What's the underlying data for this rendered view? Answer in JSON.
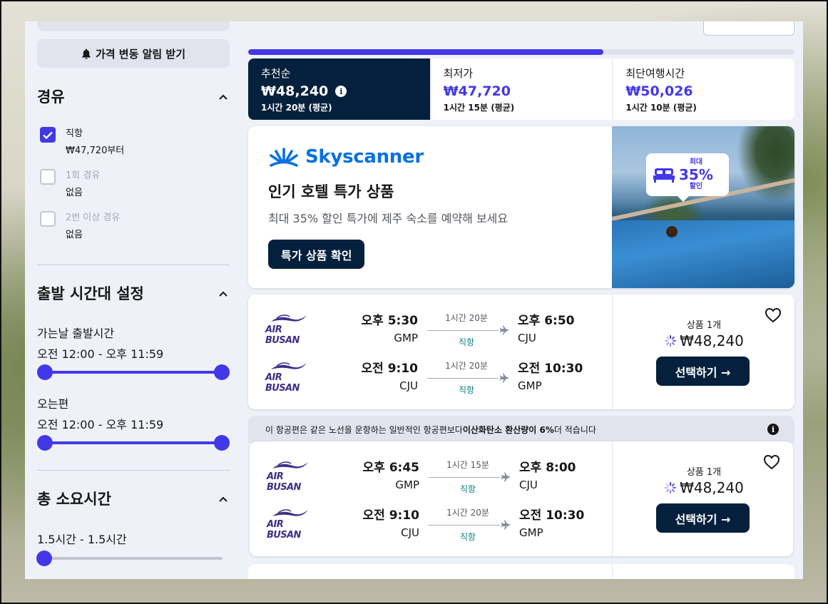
{
  "sidebar": {
    "price_alert_label": "가격 변동 알림 받기",
    "stops": {
      "title": "경유",
      "options": [
        {
          "label": "직항",
          "sub": "₩47,720부터",
          "checked": true,
          "disabled": false
        },
        {
          "label": "1회 경유",
          "sub": "없음",
          "checked": false,
          "disabled": true
        },
        {
          "label": "2번 이상 경유",
          "sub": "없음",
          "checked": false,
          "disabled": true
        }
      ]
    },
    "departure_times": {
      "title": "출발 시간대 설정",
      "outbound_label": "가는날 출발시간",
      "outbound_range": "오전 12:00 - 오후 11:59",
      "return_label": "오는편",
      "return_range": "오전 12:00 - 오후 11:59"
    },
    "duration": {
      "title": "총 소요시간",
      "range": "1.5시간 - 1.5시간"
    }
  },
  "progress": {
    "fraction": 0.65
  },
  "sort_tabs": [
    {
      "label": "추천순",
      "price": "₩48,240",
      "sub": "1시간 20분 (평균)",
      "active": true
    },
    {
      "label": "최저가",
      "price": "₩47,720",
      "sub": "1시간 15분 (평균)",
      "active": false
    },
    {
      "label": "최단여행시간",
      "price": "₩50,026",
      "sub": "1시간 10분 (평균)",
      "active": false
    }
  ],
  "ad": {
    "brand": "Skyscanner",
    "title": "인기 호텔 특가 상품",
    "subtitle": "최대 35% 할인 특가에 제주 숙소를 예약해 보세요",
    "button_label": "특가 상품 확인",
    "badge_small": "최대",
    "badge_big": "35%",
    "badge_bottom": "할인"
  },
  "eco_banner": {
    "text_before": "이 항공편은 같은 노선을 운항하는 일반적인 항공편보다 ",
    "text_bold": "이산화탄소 환산량이 6%",
    "text_after": " 더 적습니다"
  },
  "flights": [
    {
      "deals": "상품 1개",
      "price": "₩48,240",
      "select_label": "선택하기 →",
      "legs": [
        {
          "airline": "AIR BUSAN",
          "dep_time": "오후 5:30",
          "dep_code": "GMP",
          "duration": "1시간 20분",
          "stops": "직항",
          "arr_time": "오후 6:50",
          "arr_code": "CJU"
        },
        {
          "airline": "AIR BUSAN",
          "dep_time": "오전 9:10",
          "dep_code": "CJU",
          "duration": "1시간 20분",
          "stops": "직항",
          "arr_time": "오전 10:30",
          "arr_code": "GMP"
        }
      ]
    },
    {
      "deals": "상품 1개",
      "price": "₩48,240",
      "select_label": "선택하기 →",
      "legs": [
        {
          "airline": "AIR BUSAN",
          "dep_time": "오후 6:45",
          "dep_code": "GMP",
          "duration": "1시간 15분",
          "stops": "직항",
          "arr_time": "오후 8:00",
          "arr_code": "CJU"
        },
        {
          "airline": "AIR BUSAN",
          "dep_time": "오전 9:10",
          "dep_code": "CJU",
          "duration": "1시간 20분",
          "stops": "직항",
          "arr_time": "오전 10:30",
          "arr_code": "GMP"
        }
      ]
    }
  ],
  "colors": {
    "accent": "#4338e8",
    "navy": "#05203c",
    "stops_teal": "#0c838a",
    "skyscanner_blue": "#0770e3"
  }
}
